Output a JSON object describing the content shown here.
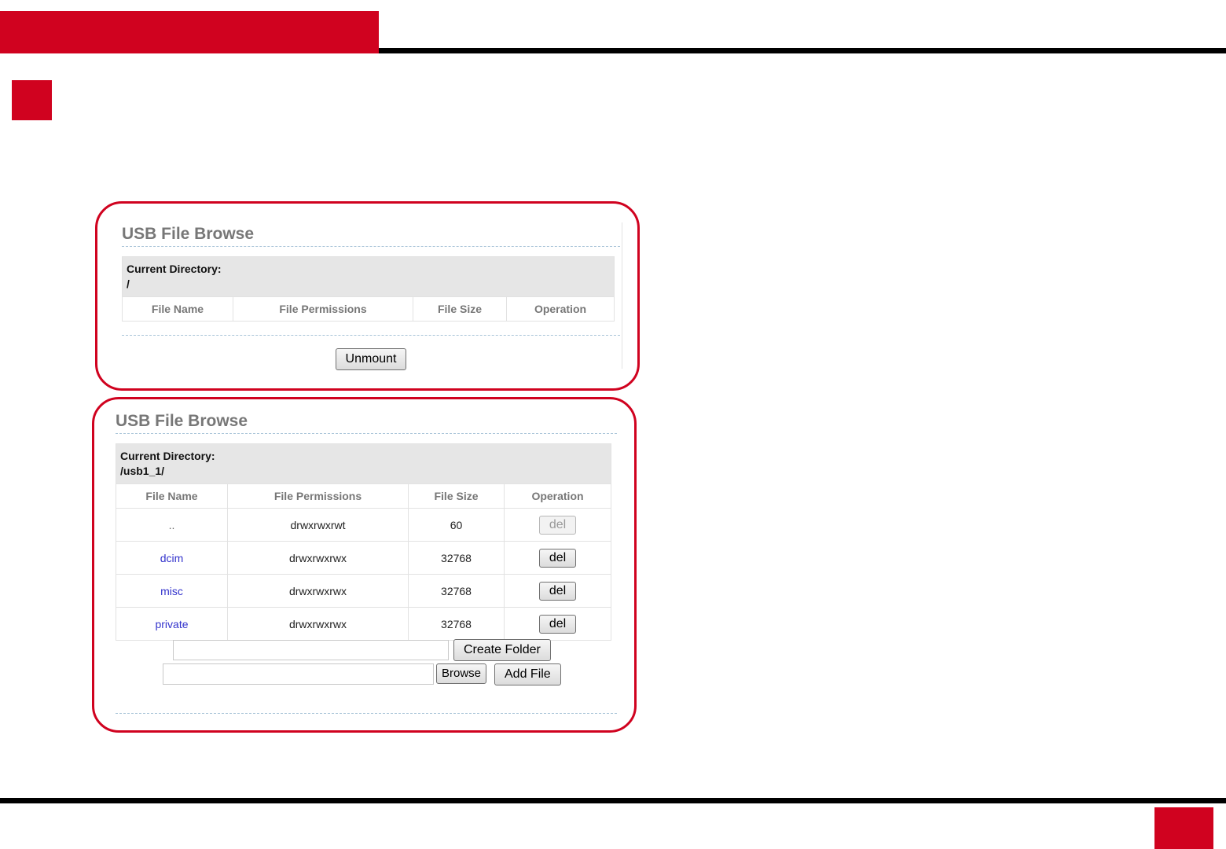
{
  "colors": {
    "brand": "#d0021f",
    "link": "#3333cc",
    "rule": "#000000"
  },
  "panel1": {
    "title": "USB File Browse",
    "current_directory_label": "Current Directory:",
    "current_directory": "/",
    "columns": [
      "File Name",
      "File Permissions",
      "File Size",
      "Operation"
    ],
    "unmount_label": "Unmount"
  },
  "panel2": {
    "title": "USB File Browse",
    "current_directory_label": "Current Directory:",
    "current_directory": "/usb1_1/",
    "columns": [
      "File Name",
      "File Permissions",
      "File Size",
      "Operation"
    ],
    "rows": [
      {
        "name": "..",
        "permissions": "drwxrwxrwt",
        "size": "60",
        "op": "del"
      },
      {
        "name": "dcim",
        "permissions": "drwxrwxrwx",
        "size": "32768",
        "op": "del"
      },
      {
        "name": "misc",
        "permissions": "drwxrwxrwx",
        "size": "32768",
        "op": "del"
      },
      {
        "name": "private",
        "permissions": "drwxrwxrwx",
        "size": "32768",
        "op": "del"
      }
    ],
    "folder_input_value": "",
    "create_folder_label": "Create Folder",
    "file_input_value": "",
    "browse_label": "Browse",
    "add_file_label": "Add File"
  }
}
